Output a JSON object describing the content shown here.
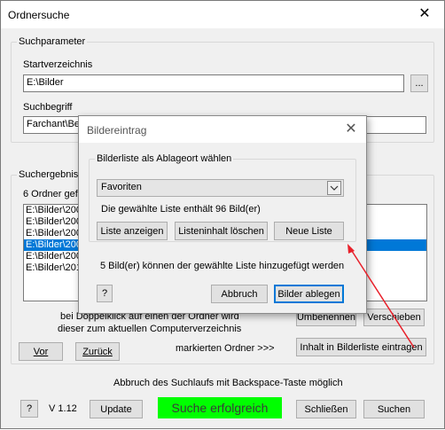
{
  "window": {
    "title": "Ordnersuche",
    "close_glyph": "✕"
  },
  "params": {
    "legend": "Suchparameter",
    "startdir_label": "Startverzeichnis",
    "startdir_value": "E:\\Bilder",
    "browse_label": "...",
    "term_label": "Suchbegriff",
    "term_value": "Farchant\\Be"
  },
  "results": {
    "legend": "Suchergebnis",
    "count_text": "6 Ordner gef",
    "items": [
      "E:\\Bilder\\200",
      "E:\\Bilder\\200",
      "E:\\Bilder\\200",
      "E:\\Bilder\\200",
      "E:\\Bilder\\200",
      "E:\\Bilder\\201"
    ],
    "selected_index": 3,
    "hint_line1": "bei Doppelklick auf einen der Ordner wird",
    "hint_line2": "dieser zum aktuellen Computerverzeichnis",
    "marked_text": "markierten Ordner >>>",
    "btn_vor": "Vor",
    "btn_zurueck": "Zurück",
    "btn_umbenennen": "Umbenennen",
    "btn_verschieben": "Verschieben",
    "btn_inhalt": "Inhalt in Bilderliste eintragen"
  },
  "footer": {
    "abort_hint": "Abbruch des Suchlaufs mit Backspace-Taste möglich",
    "help": "?",
    "version": "V 1.12",
    "btn_update": "Update",
    "status": "Suche erfolgreich",
    "status_color": "#00ff00",
    "btn_close": "Schließen",
    "btn_search": "Suchen"
  },
  "dialog": {
    "title": "Bildereintrag",
    "close_glyph": "✕",
    "group_legend": "Bilderliste als Ablageort wählen",
    "combo_value": "Favoriten",
    "combo_arrow": "chevron-down",
    "list_info": "Die gewählte Liste enthält 96 Bild(er)",
    "btn_show": "Liste anzeigen",
    "btn_clear": "Listeninhalt löschen",
    "btn_new": "Neue Liste",
    "add_info": "5  Bild(er) können der gewählte Liste hinzugefügt werden",
    "help": "?",
    "btn_cancel": "Abbruch",
    "btn_store": "Bilder ablegen"
  },
  "annotation": {
    "arrow_color": "#e8202a"
  }
}
